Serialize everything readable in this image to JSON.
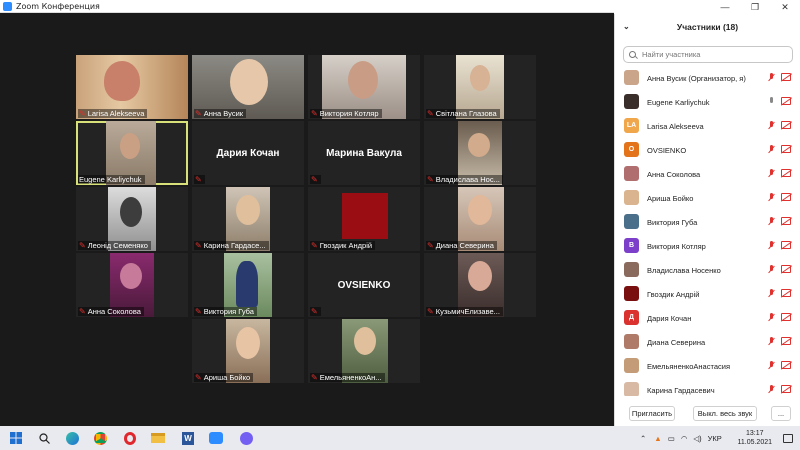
{
  "window": {
    "title": "Zoom Конференция"
  },
  "tiles": [
    {
      "name": "Larisa Alekseeva"
    },
    {
      "name": "Анна Вусик"
    },
    {
      "name": "Виктория Котляр"
    },
    {
      "name": "Світлана Глазова"
    },
    {
      "name": "Eugene Karliychuk"
    },
    {
      "name": "Дария Кочан"
    },
    {
      "name": "Марина Вакула"
    },
    {
      "name": "Владислава Нос..."
    },
    {
      "name": "Леонід Семеняко"
    },
    {
      "name": "Карина Гардасе..."
    },
    {
      "name": "Гвоздик Андрій"
    },
    {
      "name": "Диана Северина"
    },
    {
      "name": "Анна Соколова"
    },
    {
      "name": "Виктория Губа"
    },
    {
      "name": "OVSIENKO"
    },
    {
      "name": "КузьмичЕлизаве..."
    },
    {
      "name": "Ариша Бойко"
    },
    {
      "name": "ЕмельяненкоАн..."
    }
  ],
  "participants": {
    "title": "Участники (18)",
    "search_placeholder": "Найти участника",
    "list": [
      {
        "name": "Анна Вусик (Организатор, я)",
        "initials": "",
        "color": "#caa58a"
      },
      {
        "name": "Eugene Karliychuk",
        "initials": "",
        "color": "#3a2e2a"
      },
      {
        "name": "Larisa Alekseeva",
        "initials": "LA",
        "color": "#f0a64a"
      },
      {
        "name": "OVSIENKO",
        "initials": "O",
        "color": "#e4741c"
      },
      {
        "name": "Анна Соколова",
        "initials": "",
        "color": "#b06e6e"
      },
      {
        "name": "Ариша Бойко",
        "initials": "",
        "color": "#d9b48f"
      },
      {
        "name": "Виктория Губа",
        "initials": "",
        "color": "#4a6f8a"
      },
      {
        "name": "Виктория Котляр",
        "initials": "В",
        "color": "#7b3fc9"
      },
      {
        "name": "Владислава Носенко",
        "initials": "",
        "color": "#8a6a5c"
      },
      {
        "name": "Гвоздик Андрій",
        "initials": "",
        "color": "#7a0f10"
      },
      {
        "name": "Дария Кочан",
        "initials": "Д",
        "color": "#d9322f"
      },
      {
        "name": "Диана Северина",
        "initials": "",
        "color": "#b07a68"
      },
      {
        "name": "ЕмельяненкоАнастасия",
        "initials": "",
        "color": "#c49c77"
      },
      {
        "name": "Карина Гардасевич",
        "initials": "",
        "color": "#d7b9a4"
      }
    ],
    "invite_label": "Пригласить",
    "mute_all_label": "Выкл. весь звук",
    "more_label": "..."
  },
  "taskbar": {
    "language": "УКР",
    "time": "13:17",
    "date": "11.05.2021"
  }
}
